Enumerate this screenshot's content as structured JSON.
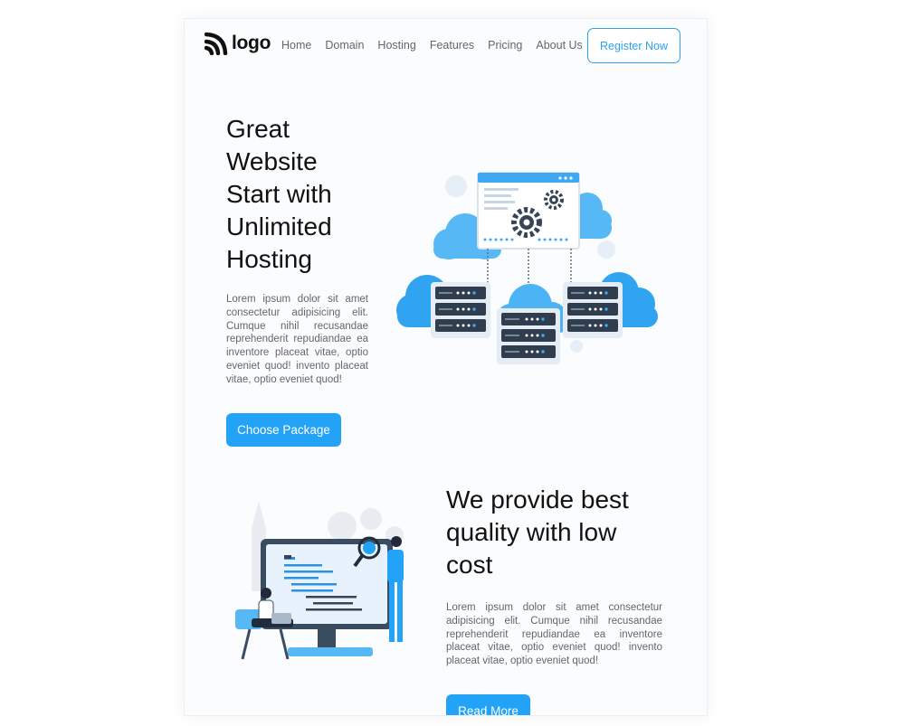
{
  "nav": {
    "logo_text": "logo",
    "items": [
      "Home",
      "Domain",
      "Hosting",
      "Features",
      "Pricing",
      "About Us"
    ],
    "register_label": "Register Now"
  },
  "hero": {
    "title": "Great Website Start with Unlimited Hosting",
    "description": "Lorem ipsum dolor sit amet consectetur adipisicing elit. Cumque nihil recusandae reprehenderit repudiandae ea inventore placeat vitae, optio eveniet quod! invento placeat vitae, optio eveniet quod!",
    "button_label": "Choose Package"
  },
  "quality": {
    "title": "We provide best quality with low cost",
    "description": "Lorem ipsum dolor sit amet consectetur adipisicing elit. Cumque nihil recusandae reprehenderit repudiandae ea inventore placeat vitae, optio eveniet quod! invento placeat vitae, optio eveniet quod!",
    "button_label": "Read More"
  },
  "colors": {
    "accent": "#23a3f7",
    "heading": "#111111",
    "body_text": "#666666"
  },
  "icons": [
    "logo-mark-icon"
  ]
}
